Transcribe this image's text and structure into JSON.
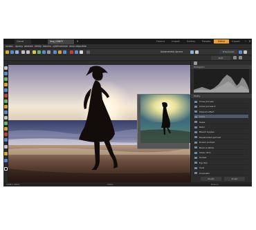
{
  "titlebar": {
    "tabs": [
      "Cloud",
      "img_00837"
    ],
    "nav": [
      "Gerent",
      "Import",
      "Gallery",
      "Presets",
      "Editor",
      "Export"
    ],
    "window_controls": [
      "minimize",
      "maximize",
      "close"
    ]
  },
  "menubar": {
    "items": [
      "soubor",
      "úpravy",
      "obrázek",
      "efekty",
      "tabulka",
      "výběr",
      "nástroje",
      "okno",
      "nápověda"
    ]
  },
  "toolbar": {
    "enhance_label": "Automatická úprava",
    "zoom_label": "Přizpůsobit",
    "undo_label": "Zpět"
  },
  "canvas": {
    "alt": "Silhouette of a woman on the beach at sunset"
  },
  "status": {
    "left": "5488 x 3659",
    "middle": "100%",
    "right": "Hotovo"
  },
  "rightpanel": {
    "histogram_label": "Histogram",
    "presets_label": "Efekty",
    "presets": [
      "Cross process",
      "Cross process 2",
      "Polaroid effect",
      "Lomo",
      "Sepia",
      "Retro",
      "Bleach bypass",
      "Desaturated portrait",
      "Dream portrait",
      "Black & White",
      "Silver retro",
      "Sunset",
      "Fuji film",
      "Vivid",
      "Cinematic"
    ],
    "selected_index": 3,
    "apply_button": "Použít",
    "cancel_button": "Zrušit"
  },
  "colors": {
    "accent": "#f0a020",
    "panel": "#2c2c2c",
    "selection": "#4a5a6a"
  }
}
